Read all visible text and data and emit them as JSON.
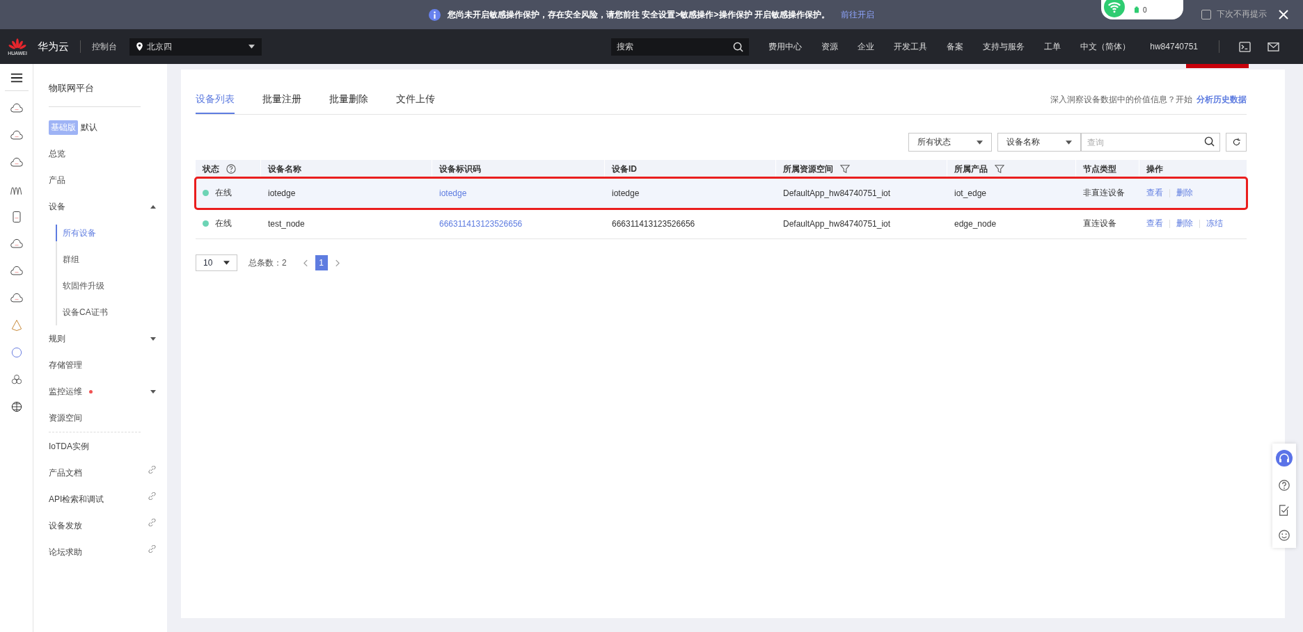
{
  "notice": {
    "text": "您尚未开启敏感操作保护，存在安全风险，请您前往 安全设置>敏感操作>操作保护 开启敏感操作保护。",
    "link": "前往开启",
    "dont_show": {
      "label": "下次不再提示",
      "checked": false
    }
  },
  "network_popup": {
    "count": "0"
  },
  "nav": {
    "logo_text": "HUAWEI",
    "brand": "华为云",
    "console": "控制台",
    "region": "北京四",
    "search_placeholder": "搜索",
    "menu": [
      "费用中心",
      "资源",
      "企业",
      "开发工具",
      "备案",
      "支持与服务",
      "工单",
      "中文（简体）"
    ],
    "user": "hw84740751"
  },
  "sidebar": {
    "title": "物联网平台",
    "edition_badge": "基础版",
    "edition": "默认",
    "items": [
      {
        "label": "总览",
        "kind": "plain"
      },
      {
        "label": "产品",
        "kind": "plain"
      },
      {
        "label": "设备",
        "kind": "group",
        "expanded": true,
        "children": [
          {
            "label": "所有设备",
            "selected": true
          },
          {
            "label": "群组",
            "selected": false
          },
          {
            "label": "软固件升级",
            "selected": false
          },
          {
            "label": "设备CA证书",
            "selected": false
          }
        ]
      },
      {
        "label": "规则",
        "kind": "group",
        "expanded": false
      },
      {
        "label": "存储管理",
        "kind": "plain"
      },
      {
        "label": "监控运维",
        "kind": "group",
        "expanded": false,
        "alert": true
      },
      {
        "label": "资源空间",
        "kind": "plain"
      },
      {
        "label": "IoTDA实例",
        "kind": "plain",
        "divider_before": true
      },
      {
        "label": "产品文档",
        "kind": "link"
      },
      {
        "label": "API检索和调试",
        "kind": "link"
      },
      {
        "label": "设备发放",
        "kind": "link"
      },
      {
        "label": "论坛求助",
        "kind": "link"
      }
    ]
  },
  "tabs": [
    {
      "label": "设备列表",
      "selected": true
    },
    {
      "label": "批量注册",
      "selected": false
    },
    {
      "label": "批量删除",
      "selected": false
    },
    {
      "label": "文件上传",
      "selected": false
    }
  ],
  "insight": {
    "text": "深入洞察设备数据中的价值信息？开始",
    "link": "分析历史数据"
  },
  "filters": {
    "status": "所有状态",
    "field": "设备名称",
    "search_placeholder": "查询"
  },
  "table": {
    "columns": [
      {
        "label": "状态",
        "kind": "help"
      },
      {
        "label": "设备名称",
        "kind": "plain"
      },
      {
        "label": "设备标识码",
        "kind": "plain"
      },
      {
        "label": "设备ID",
        "kind": "plain"
      },
      {
        "label": "所属资源空间",
        "kind": "filter"
      },
      {
        "label": "所属产品",
        "kind": "filter"
      },
      {
        "label": "节点类型",
        "kind": "plain"
      },
      {
        "label": "操作",
        "kind": "plain"
      }
    ],
    "rows": [
      {
        "status": "在线",
        "color": "#6cd4b5",
        "name": "iotedge",
        "code": "iotedge",
        "id": "iotedge",
        "space": "DefaultApp_hw84740751_iot",
        "product": "iot_edge",
        "node_type": "非直连设备",
        "actions": [
          "查看",
          "删除"
        ],
        "highlighted": true
      },
      {
        "status": "在线",
        "color": "#6cd4b5",
        "name": "test_node",
        "code": "666311413123526656",
        "id": "666311413123526656",
        "space": "DefaultApp_hw84740751_iot",
        "product": "edge_node",
        "node_type": "直连设备",
        "actions": [
          "查看",
          "删除",
          "冻结"
        ],
        "highlighted": false
      }
    ]
  },
  "pagination": {
    "page_size": "10",
    "total": "总条数：2",
    "pages": [
      {
        "label": "1",
        "selected": true
      }
    ]
  }
}
